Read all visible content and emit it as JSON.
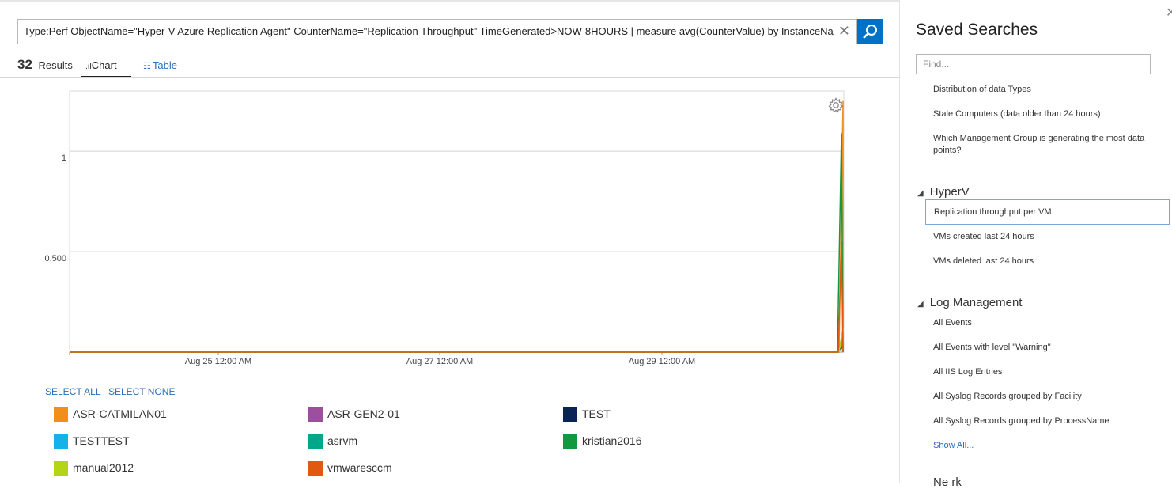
{
  "query": {
    "text": "Type:Perf ObjectName=\"Hyper-V Azure Replication Agent\" CounterName=\"Replication Throughput\" TimeGenerated>NOW-8HOURS | measure  avg(CounterValue) by InstanceNa",
    "clear_glyph": "✕",
    "search_icon": "search-icon"
  },
  "results": {
    "count": "32",
    "label": "Results"
  },
  "tabs": [
    {
      "label": "Chart",
      "glyph": ".ıl",
      "active": true
    },
    {
      "label": "Table",
      "glyph": "☷",
      "active": false
    }
  ],
  "chart_data": {
    "type": "line",
    "y_ticks": [
      "1",
      "0.500"
    ],
    "x_ticks": [
      "Aug 25 12:00 AM",
      "Aug 27 12:00 AM",
      "Aug 29 12:00 AM"
    ],
    "x": [
      "Aug 24 08:00 PM",
      "Aug 30 12:00 PM"
    ],
    "ylim": [
      0,
      1.3
    ],
    "grid": true,
    "series": [
      {
        "name": "ASR-CATMILAN01",
        "color": "#f28e1c",
        "values": [
          0,
          1.25
        ]
      },
      {
        "name": "ASR-GEN2-01",
        "color": "#9c4f9c",
        "values": [
          0,
          0.04
        ]
      },
      {
        "name": "TEST",
        "color": "#0a2555",
        "values": [
          0,
          0.03
        ]
      },
      {
        "name": "TESTTEST",
        "color": "#15b2ea",
        "values": [
          0,
          0.07
        ]
      },
      {
        "name": "asrvm",
        "color": "#00a88a",
        "values": [
          0,
          0.1
        ]
      },
      {
        "name": "kristian2016",
        "color": "#12993f",
        "values": [
          0,
          1.09
        ]
      },
      {
        "name": "manual2012",
        "color": "#b4d416",
        "values": [
          0,
          0.12
        ]
      },
      {
        "name": "vmwaresccm",
        "color": "#e15810",
        "values": [
          0,
          0.55
        ]
      }
    ]
  },
  "chart_controls": {
    "select_all": "SELECT ALL",
    "select_none": "SELECT NONE",
    "settings_icon": "gear-icon"
  },
  "sidebar": {
    "title": "Saved Searches",
    "close_glyph": "✕",
    "find_placeholder": "Find...",
    "ungrouped": [
      "Distribution of data Types",
      "Stale Computers (data older than 24 hours)",
      "Which Management Group is generating the most data points?"
    ],
    "groups": [
      {
        "name": "HyperV",
        "items": [
          "Replication throughput per VM",
          "VMs created last 24 hours",
          "VMs deleted last 24 hours"
        ]
      },
      {
        "name": "Log Management",
        "items": [
          "All Events",
          "All Events with level \"Warning\"",
          "All IIS Log Entries",
          "All Syslog Records grouped by Facility",
          "All Syslog Records grouped by ProcessName"
        ]
      }
    ],
    "show_all": "Show All...",
    "next_group_partial": "Ne    rk"
  }
}
